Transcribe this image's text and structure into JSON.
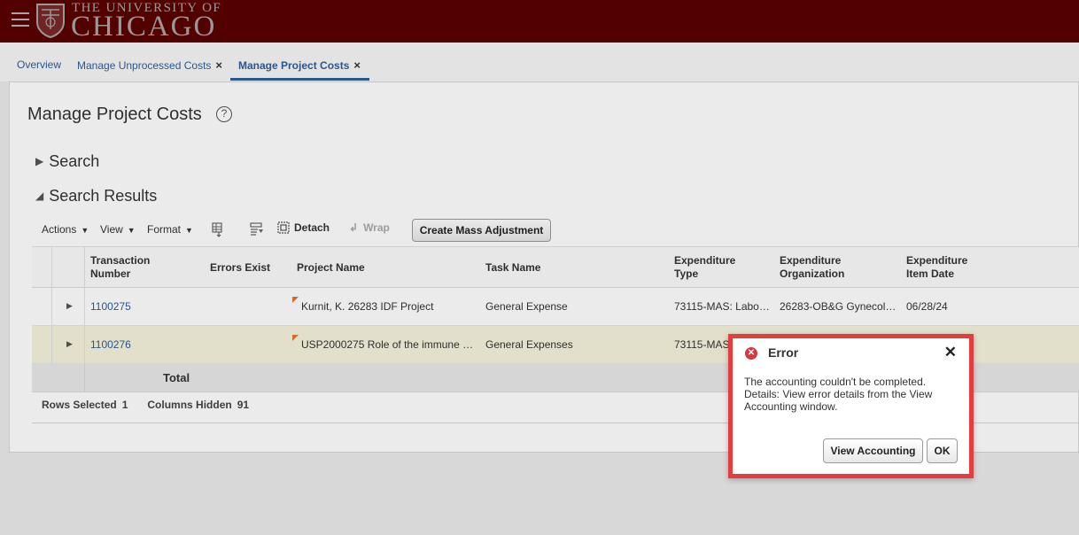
{
  "header": {
    "logo_top": "THE UNIVERSITY OF",
    "logo_main": "CHICAGO",
    "brand_color": "#800000"
  },
  "tabs": [
    {
      "label": "Overview",
      "closable": false,
      "active": false
    },
    {
      "label": "Manage Unprocessed Costs",
      "closable": true,
      "active": false
    },
    {
      "label": "Manage Project Costs",
      "closable": true,
      "active": true
    }
  ],
  "tab_close_glyph": "×",
  "page": {
    "title": "Manage Project Costs",
    "help_glyph": "?",
    "search_section": "Search",
    "results_section": "Search Results"
  },
  "toolbar": {
    "actions": "Actions",
    "view": "View",
    "format": "Format",
    "detach": "Detach",
    "wrap": "Wrap",
    "create_mass_adjustment": "Create Mass Adjustment"
  },
  "table": {
    "columns": [
      {
        "line1": "Transaction",
        "line2": "Number"
      },
      {
        "line1": "Errors Exist",
        "line2": ""
      },
      {
        "line1": "Project Name",
        "line2": ""
      },
      {
        "line1": "Task Name",
        "line2": ""
      },
      {
        "line1": "Expenditure",
        "line2": "Type"
      },
      {
        "line1": "Expenditure",
        "line2": "Organization"
      },
      {
        "line1": "Expenditure",
        "line2": "Item Date"
      }
    ],
    "rows": [
      {
        "transaction_number": "1100275",
        "errors_exist": "",
        "project_name": "Kurnit, K. 26283 IDF Project",
        "task_name": "General Expense",
        "expenditure_type": "73115-MAS: Labo…",
        "expenditure_organization": "26283-OB&G Gynecol…",
        "item_date": "06/28/24"
      },
      {
        "transaction_number": "1100276",
        "errors_exist": "",
        "project_name": "USP2000275 Role of the immune …",
        "task_name": "General Expenses",
        "expenditure_type": "73115-MAS",
        "expenditure_organization": "",
        "item_date": ""
      }
    ],
    "total_label": "Total"
  },
  "footer": {
    "rows_selected_label": "Rows Selected",
    "rows_selected_value": "1",
    "columns_hidden_label": "Columns Hidden",
    "columns_hidden_value": "91"
  },
  "dialog": {
    "title": "Error",
    "message": "The accounting couldn't be completed. Details: View error details from the View Accounting window.",
    "view_accounting_button": "View Accounting",
    "ok_button": "OK",
    "close_glyph": "✕",
    "icon_glyph": "✕",
    "frame_color": "#e53d3d"
  }
}
